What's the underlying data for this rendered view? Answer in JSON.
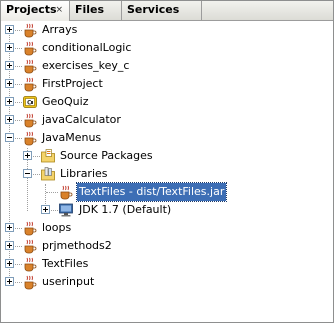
{
  "tabs": [
    {
      "label": "Projects",
      "close": "×",
      "active": true
    },
    {
      "label": "Files",
      "active": false
    },
    {
      "label": "Services",
      "active": false
    }
  ],
  "projects": [
    {
      "label": "Arrays"
    },
    {
      "label": "conditionalLogic"
    },
    {
      "label": "exercises_key_c"
    },
    {
      "label": "FirstProject"
    },
    {
      "label": "GeoQuiz"
    },
    {
      "label": "javaCalculator"
    },
    {
      "label": "JavaMenus"
    },
    {
      "label": "loops"
    },
    {
      "label": "prjmethods2"
    },
    {
      "label": "TextFiles"
    },
    {
      "label": "userinput"
    }
  ],
  "javamenus_children": [
    {
      "label": "Source Packages"
    },
    {
      "label": "Libraries"
    }
  ],
  "libraries_children": [
    {
      "label": "TextFiles - dist/TextFiles.jar",
      "selected": true
    },
    {
      "label": "JDK 1.7 (Default)"
    }
  ],
  "colors": {
    "selection": "#3d6eb5",
    "tab_border": "#9c9c9c"
  }
}
